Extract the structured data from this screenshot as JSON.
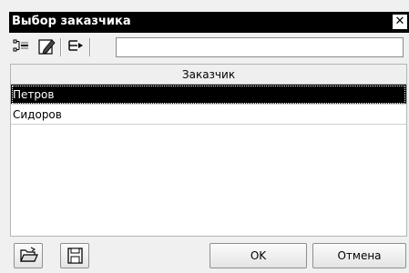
{
  "window": {
    "title": "Выбор заказчика",
    "close_glyph": "✕"
  },
  "toolbar": {
    "buttons": [
      {
        "name": "expand-tree-icon"
      },
      {
        "name": "edit-icon"
      },
      {
        "name": "insert-icon"
      }
    ],
    "search_value": ""
  },
  "grid": {
    "column_header": "Заказчик",
    "rows": [
      {
        "label": "Петров",
        "selected": true
      },
      {
        "label": "Сидоров",
        "selected": false
      }
    ]
  },
  "footer": {
    "open_icon": "folder-open-icon",
    "save_icon": "save-icon",
    "ok_label": "OK",
    "cancel_label": "Отмена"
  },
  "colors": {
    "titlebar_bg": "#000000",
    "selection_bg": "#000000",
    "panel_bg": "#f0f0f0"
  }
}
